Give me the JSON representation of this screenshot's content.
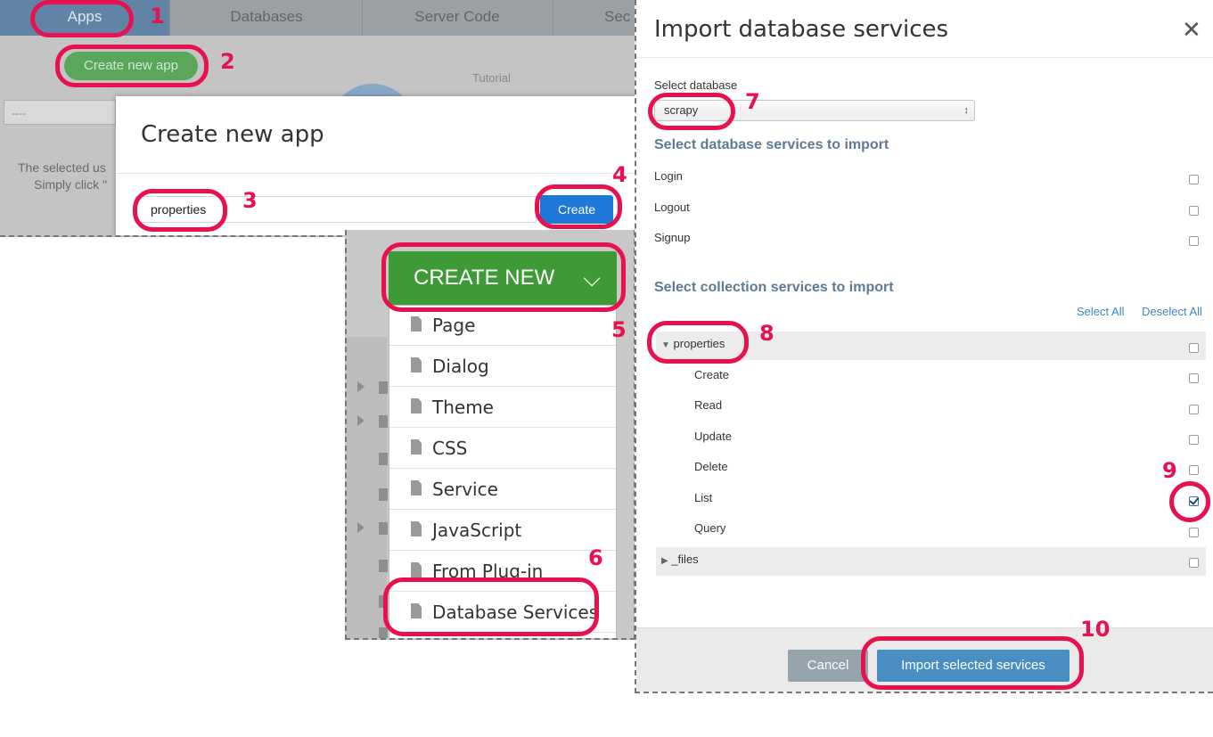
{
  "apps_screen": {
    "nav_tabs": [
      "Apps",
      "Databases",
      "Server Code",
      "Sec"
    ],
    "create_app_button": "Create new app",
    "select_placeholder": "----",
    "tutorial_label": "Tutorial",
    "left_text_1": "The selected us",
    "left_text_2": "Simply click \""
  },
  "create_app_dialog": {
    "title": "Create new app",
    "app_name_value": "properties",
    "create_button": "Create"
  },
  "create_new_menu": {
    "button_label": "CREATE NEW",
    "chevron_icon": "chevron-down-icon",
    "items": [
      "Page",
      "Dialog",
      "Theme",
      "CSS",
      "Service",
      "JavaScript",
      "From Plug-in",
      "Database Services"
    ]
  },
  "import_dialog": {
    "title": "Import database services",
    "close_icon": "close-icon",
    "select_database_label": "Select database",
    "selected_database": "scrapy",
    "db_services_heading": "Select database services to import",
    "db_services": [
      {
        "label": "Login",
        "checked": false
      },
      {
        "label": "Logout",
        "checked": false
      },
      {
        "label": "Signup",
        "checked": false
      }
    ],
    "collection_heading": "Select collection services to import",
    "select_all": "Select All",
    "deselect_all": "Deselect All",
    "collection_name": "properties",
    "collection_services": [
      {
        "label": "Create",
        "checked": false
      },
      {
        "label": "Read",
        "checked": false
      },
      {
        "label": "Update",
        "checked": false
      },
      {
        "label": "Delete",
        "checked": false
      },
      {
        "label": "List",
        "checked": true
      },
      {
        "label": "Query",
        "checked": false
      }
    ],
    "files_collection": "_files",
    "cancel_button": "Cancel",
    "import_button": "Import selected services"
  },
  "annotations": [
    "1",
    "2",
    "3",
    "4",
    "5",
    "6",
    "7",
    "8",
    "9",
    "10"
  ],
  "colors": {
    "highlight": "#e8114f",
    "create_green": "#3e9a36",
    "primary_blue": "#1d78d8",
    "heading_blue_gray": "#5f7a93"
  }
}
